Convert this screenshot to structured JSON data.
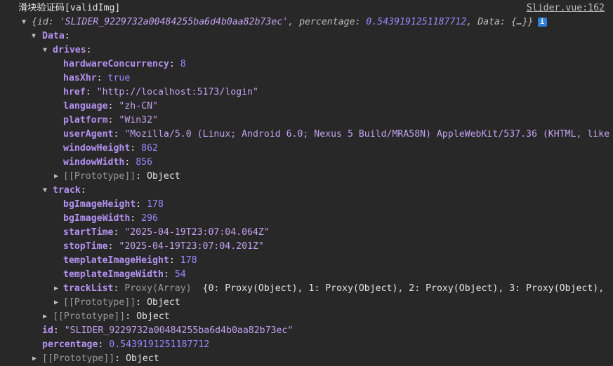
{
  "header": {
    "log_message": "滑块验证码[validImg]",
    "source_link": "Slider.vue:162"
  },
  "summary": {
    "text_open": "{id: ",
    "id_value": "'SLIDER_9229732a00484255ba6d4b0aa82b73ec'",
    "text_mid": ", percentage: ",
    "percentage_value": "0.5439191251187712",
    "text_tail": ", Data: {…}}",
    "info_icon_label": "i"
  },
  "tree": {
    "data_key": "Data",
    "drives_key": "drives",
    "drives": {
      "hardwareConcurrency_key": "hardwareConcurrency",
      "hardwareConcurrency": "8",
      "hasXhr_key": "hasXhr",
      "hasXhr": "true",
      "href_key": "href",
      "href": "\"http://localhost:5173/login\"",
      "language_key": "language",
      "language": "\"zh-CN\"",
      "platform_key": "platform",
      "platform": "\"Win32\"",
      "userAgent_key": "userAgent",
      "userAgent": "\"Mozilla/5.0 (Linux; Android 6.0; Nexus 5 Build/MRA58N) AppleWebKit/537.36 (KHTML, like",
      "windowHeight_key": "windowHeight",
      "windowHeight": "862",
      "windowWidth_key": "windowWidth",
      "windowWidth": "856"
    },
    "prototype_label": "[[Prototype]]",
    "prototype_value": "Object",
    "track_key": "track",
    "track": {
      "bgImageHeight_key": "bgImageHeight",
      "bgImageHeight": "178",
      "bgImageWidth_key": "bgImageWidth",
      "bgImageWidth": "296",
      "startTime_key": "startTime",
      "startTime": "\"2025-04-19T23:07:04.064Z\"",
      "stopTime_key": "stopTime",
      "stopTime": "\"2025-04-19T23:07:04.201Z\"",
      "templateImageHeight_key": "templateImageHeight",
      "templateImageHeight": "178",
      "templateImageWidth_key": "templateImageWidth",
      "templateImageWidth": "54",
      "trackList_key": "trackList",
      "trackList_type": "Proxy(Array)",
      "trackList_preview": "{0: Proxy(Object), 1: Proxy(Object), 2: Proxy(Object), 3: Proxy(Object),"
    },
    "id_key": "id",
    "id": "\"SLIDER_9229732a00484255ba6d4b0aa82b73ec\"",
    "percentage_key": "percentage",
    "percentage": "0.5439191251187712"
  },
  "icons": {
    "expanded": "▼",
    "collapsed": "▶"
  }
}
